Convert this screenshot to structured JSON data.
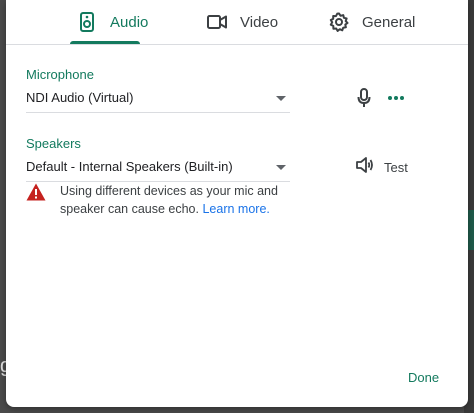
{
  "tabs": {
    "audio": {
      "label": "Audio",
      "icon": "speaker-device-icon",
      "selected": true
    },
    "video": {
      "label": "Video",
      "icon": "video-camera-icon"
    },
    "general": {
      "label": "General",
      "icon": "gear-icon"
    }
  },
  "microphone": {
    "label": "Microphone",
    "selected_value": "NDI Audio (Virtual)",
    "icons": [
      "microphone-icon",
      "more-options-icon"
    ]
  },
  "speakers": {
    "label": "Speakers",
    "selected_value": "Default - Internal Speakers (Built-in)",
    "test_label": "Test",
    "test_icon": "volume-icon"
  },
  "warning": {
    "message": "Using different devices as your mic and speaker can cause echo.",
    "link_text": "Learn more."
  },
  "footer": {
    "done_label": "Done"
  },
  "colors": {
    "accent": "#137a5e",
    "link": "#1a73e8",
    "warning": "#c5221f"
  }
}
